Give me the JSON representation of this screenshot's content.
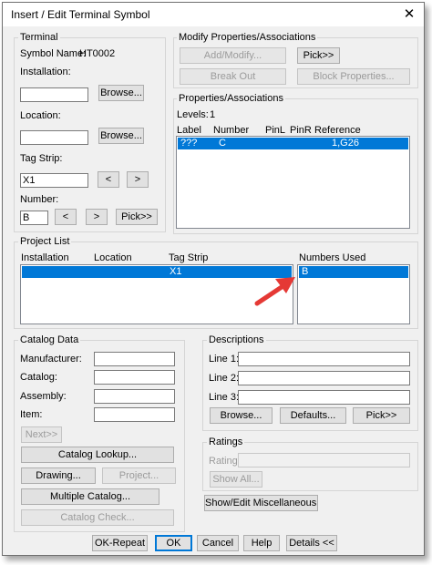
{
  "window": {
    "title": "Insert / Edit Terminal Symbol",
    "close_glyph": "✕"
  },
  "terminal": {
    "group_title": "Terminal",
    "symbol_name_label": "Symbol Name:",
    "symbol_name_value": "HT0002",
    "installation_label": "Installation:",
    "installation_value": "",
    "location_label": "Location:",
    "location_value": "",
    "tagstrip_label": "Tag Strip:",
    "tagstrip_value": "X1",
    "number_label": "Number:",
    "number_value": "B",
    "browse_label": "Browse...",
    "prev_label": "<",
    "next_label": ">",
    "pick_label": "Pick>>"
  },
  "modify": {
    "group_title": "Modify Properties/Associations",
    "add_modify_label": "Add/Modify...",
    "pick_label": "Pick>>",
    "break_out_label": "Break Out",
    "block_properties_label": "Block Properties..."
  },
  "properties": {
    "group_title": "Properties/Associations",
    "levels_label": "Levels:",
    "levels_value": "1",
    "columns": [
      "Label",
      "Number",
      "PinL",
      "PinR",
      "Reference"
    ],
    "rows": [
      {
        "label": "???",
        "number": "C",
        "pinl": "",
        "pinr": "",
        "reference": "1,G26"
      }
    ]
  },
  "project_list": {
    "group_title": "Project List",
    "columns": [
      "Installation",
      "Location",
      "Tag Strip"
    ],
    "rows": [
      {
        "installation": "",
        "location": "",
        "tag_strip": "X1"
      }
    ],
    "numbers_used_label": "Numbers Used",
    "numbers_used": [
      "B"
    ]
  },
  "catalog": {
    "group_title": "Catalog Data",
    "manufacturer_label": "Manufacturer:",
    "catalog_label": "Catalog:",
    "assembly_label": "Assembly:",
    "item_label": "Item:",
    "next_label": "Next>>",
    "catalog_lookup_label": "Catalog Lookup...",
    "drawing_label": "Drawing...",
    "project_label": "Project...",
    "multiple_catalog_label": "Multiple Catalog...",
    "catalog_check_label": "Catalog Check..."
  },
  "descriptions": {
    "group_title": "Descriptions",
    "line1_label": "Line 1:",
    "line2_label": "Line 2:",
    "line3_label": "Line 3:",
    "browse_label": "Browse...",
    "defaults_label": "Defaults...",
    "pick_label": "Pick>>"
  },
  "ratings": {
    "group_title": "Ratings",
    "rating_label": "Rating:",
    "show_all_label": "Show All..."
  },
  "misc": {
    "show_edit_label": "Show/Edit Miscellaneous..."
  },
  "footer": {
    "ok_repeat_label": "OK-Repeat",
    "ok_label": "OK",
    "cancel_label": "Cancel",
    "help_label": "Help",
    "details_label": "Details <<"
  },
  "colors": {
    "selection": "#0078d7",
    "annotation_arrow": "#e53935",
    "dialog_bg": "#f0f0f0"
  }
}
